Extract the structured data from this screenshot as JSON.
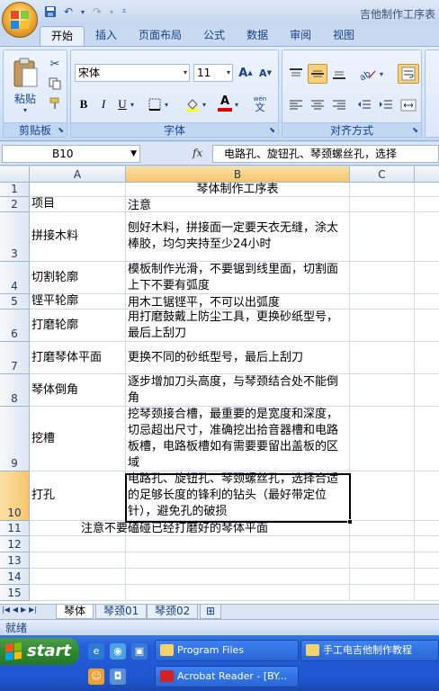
{
  "window": {
    "title": "吉他制作工序表"
  },
  "ribbon": {
    "tabs": [
      "开始",
      "插入",
      "页面布局",
      "公式",
      "数据",
      "审阅",
      "视图"
    ],
    "active_tab": "开始",
    "clipboard": {
      "paste_label": "粘贴",
      "group_label": "剪贴板"
    },
    "font": {
      "name": "宋体",
      "size": "11",
      "bold": "B",
      "italic": "I",
      "underline": "U",
      "font_color_glyph": "A",
      "wen_glyph": "wén",
      "group_label": "字体"
    },
    "alignment": {
      "group_label": "对齐方式"
    }
  },
  "formula_bar": {
    "name_box": "B10",
    "fx": "fx",
    "content": "电路孔、旋钮孔、琴颈螺丝孔，选择"
  },
  "columns": [
    "A",
    "B",
    "C"
  ],
  "rows": [
    {
      "num": "1",
      "a": "",
      "b": "琴体制作工序表"
    },
    {
      "num": "2",
      "a": "项目",
      "b": "注意"
    },
    {
      "num": "3",
      "a": "拼接木料",
      "b": "刨好木料，拼接面一定要天衣无缝，涂太棒胶，均匀夹持至少24小时"
    },
    {
      "num": "4",
      "a": "切割轮廓",
      "b": "模板制作光滑，不要锯到线里面，切割面上下不要有弧度"
    },
    {
      "num": "5",
      "a": "铿平轮廓",
      "b": "用木工锯铿平，不可以出弧度"
    },
    {
      "num": "6",
      "a": "打磨轮廓",
      "b": "用打磨鼓戴上防尘工具，更换砂纸型号，最后上刮刀"
    },
    {
      "num": "7",
      "a": "打磨琴体平面",
      "b": "更换不同的砂纸型号，最后上刮刀"
    },
    {
      "num": "8",
      "a": "琴体倒角",
      "b": "逐步增加刀头高度，与琴颈结合处不能倒角"
    },
    {
      "num": "9",
      "a": "挖槽",
      "b": "挖琴颈接合槽，最重要的是宽度和深度，切忌超出尺寸，准确挖出拾音器槽和电路板槽，电路板槽如有需要要留出盖板的区域"
    },
    {
      "num": "10",
      "a": "打孔",
      "b": "电路孔、旋钮孔、琴颈螺丝孔，选择合适的足够长度的锋利的钻头（最好带定位针），避免孔的破损"
    },
    {
      "num": "11",
      "a": "",
      "b": "",
      "note": "注意不要磕碰已经打磨好的琴体平面"
    },
    {
      "num": "12",
      "a": "",
      "b": ""
    },
    {
      "num": "13",
      "a": "",
      "b": ""
    },
    {
      "num": "14",
      "a": "",
      "b": ""
    },
    {
      "num": "15",
      "a": "",
      "b": ""
    }
  ],
  "sheets": [
    "琴体",
    "琴颈01",
    "琴颈02"
  ],
  "status": "就绪",
  "taskbar": {
    "start": "start",
    "items": [
      "Program Files",
      "手工电吉他制作教程",
      "Acrobat Reader - [BY..."
    ]
  }
}
